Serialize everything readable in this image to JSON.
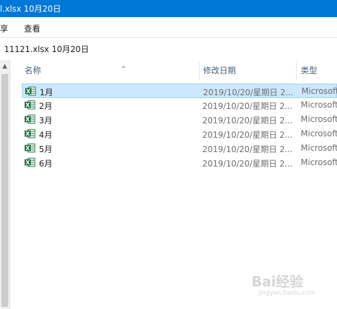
{
  "window": {
    "title": "l.xlsx 10月20日"
  },
  "menu": {
    "share_label": "享",
    "view_label": "查看"
  },
  "address": {
    "path": "11121.xlsx 10月20日"
  },
  "columns": {
    "name": "名称",
    "modified": "修改日期",
    "type": "类型"
  },
  "files": [
    {
      "name": "1月",
      "modified": "2019/10/20/星期日 2...",
      "type": "Microsoft",
      "selected": true
    },
    {
      "name": "2月",
      "modified": "2019/10/20/星期日 2...",
      "type": "Microsoft",
      "selected": false
    },
    {
      "name": "3月",
      "modified": "2019/10/20/星期日 2...",
      "type": "Microsoft",
      "selected": false
    },
    {
      "name": "4月",
      "modified": "2019/10/20/星期日 2...",
      "type": "Microsoft",
      "selected": false
    },
    {
      "name": "5月",
      "modified": "2019/10/20/星期日 2...",
      "type": "Microsoft",
      "selected": false
    },
    {
      "name": "6月",
      "modified": "2019/10/20/星期日 2...",
      "type": "Microsoft",
      "selected": false
    }
  ],
  "icons": {
    "file": "excel-file-icon",
    "sort": "sort-up-icon",
    "scroll_up": "scroll-up-icon"
  },
  "colors": {
    "titlebar": "#0078d7",
    "selection": "#cce8ff",
    "excel_green": "#1d6f42"
  },
  "watermark": {
    "text": "Bai经验",
    "sub": "jingyan.baidu.com"
  }
}
